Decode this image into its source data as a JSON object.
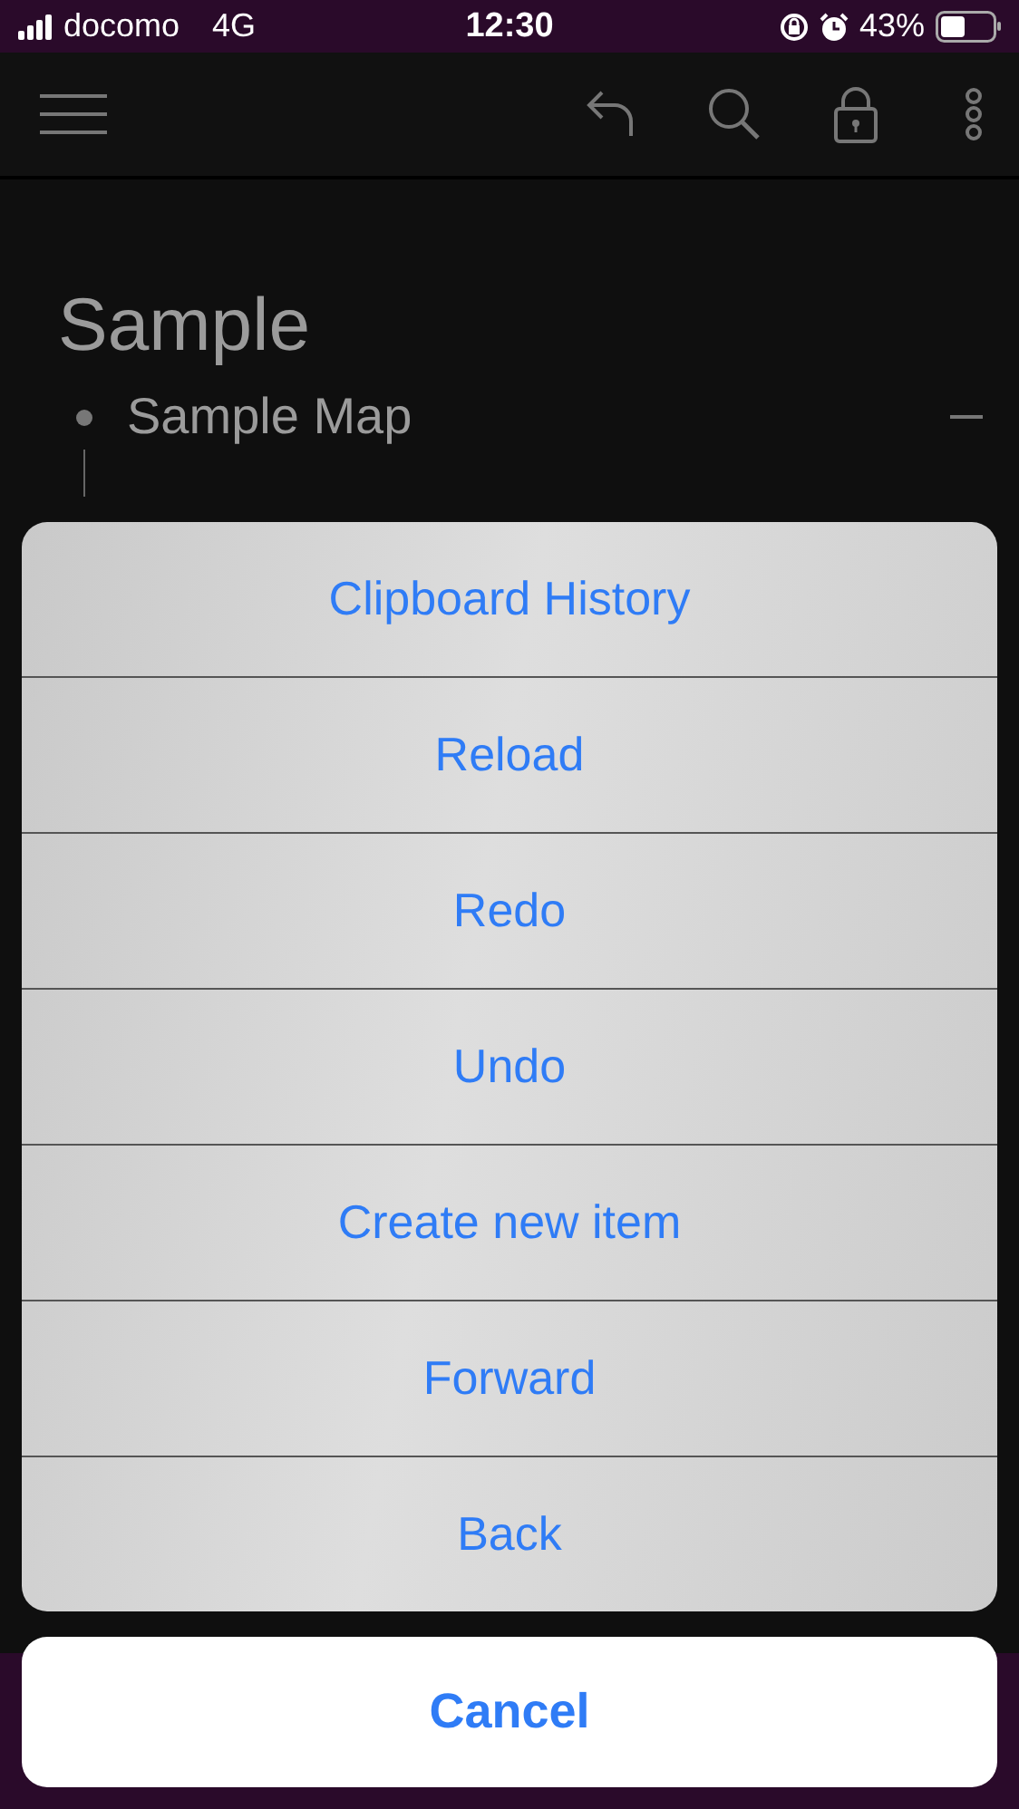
{
  "status_bar": {
    "carrier": "docomo",
    "network": "4G",
    "time": "12:30",
    "battery": "43%"
  },
  "document": {
    "title": "Sample",
    "items": [
      {
        "label": "Sample Map",
        "expanded": true
      }
    ]
  },
  "action_sheet": {
    "actions": [
      "Clipboard History",
      "Reload",
      "Redo",
      "Undo",
      "Create new item",
      "Forward",
      "Back"
    ],
    "cancel": "Cancel"
  }
}
